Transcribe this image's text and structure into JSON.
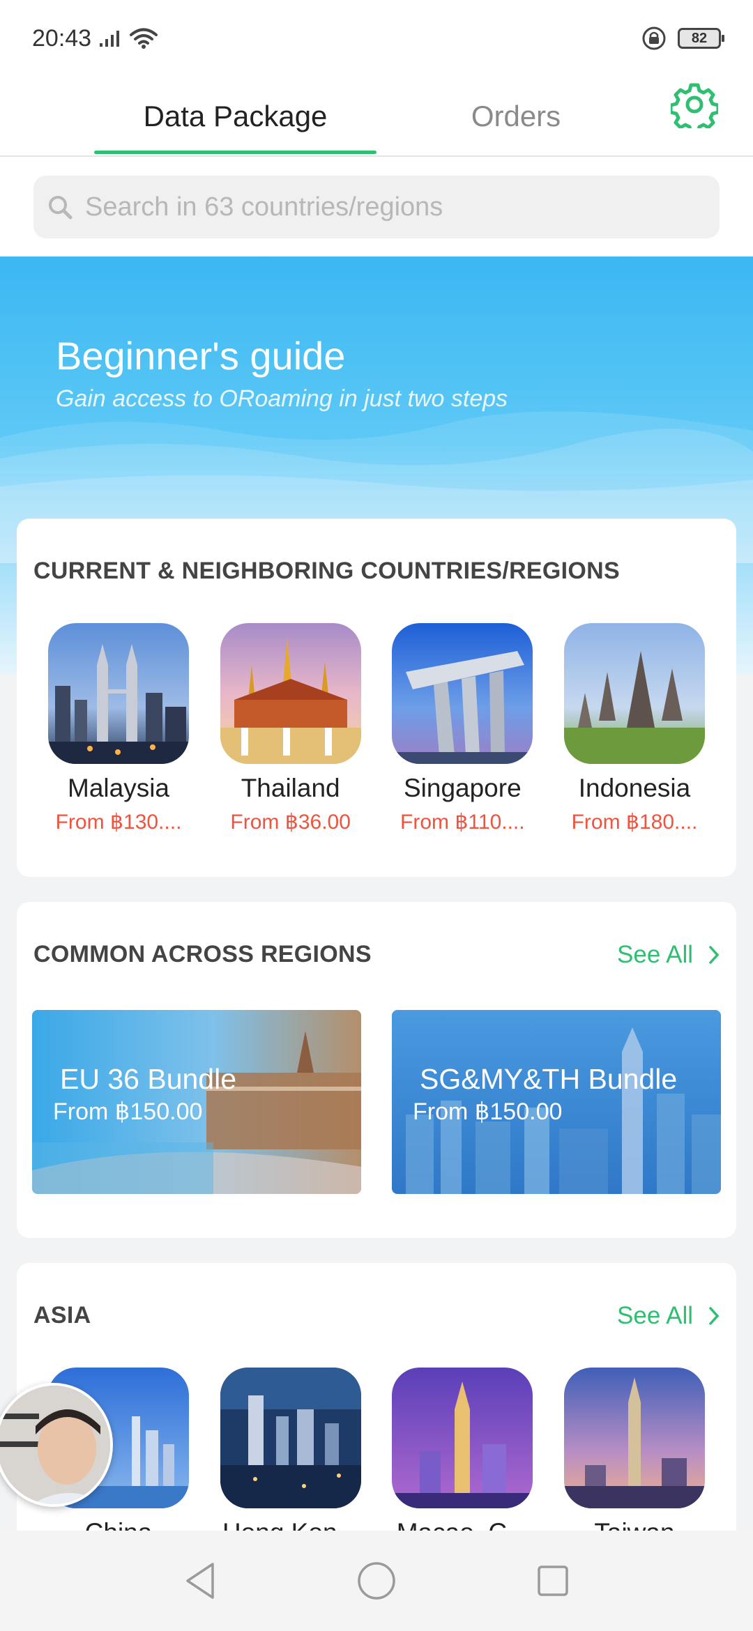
{
  "status_bar": {
    "time": "20:43",
    "battery": "82",
    "icons": [
      "signal-icon",
      "wifi-icon",
      "rotation-lock-icon",
      "battery-icon"
    ]
  },
  "tabs": [
    {
      "label": "Data Package",
      "active": true
    },
    {
      "label": "Orders",
      "active": false
    }
  ],
  "settings_icon": "gear-icon",
  "search": {
    "placeholder": "Search in 63 countries/regions",
    "value": ""
  },
  "banner": {
    "title": "Beginner's guide",
    "subtitle": "Gain access to ORoaming in just two steps"
  },
  "current_section": {
    "title": "CURRENT & NEIGHBORING COUNTRIES/REGIONS",
    "countries": [
      {
        "name": "Malaysia",
        "price": "From ฿130...."
      },
      {
        "name": "Thailand",
        "price": "From ฿36.00"
      },
      {
        "name": "Singapore",
        "price": "From ฿110...."
      },
      {
        "name": "Indonesia",
        "price": "From ฿180...."
      }
    ]
  },
  "common_section": {
    "title": "COMMON ACROSS REGIONS",
    "see_all": "See All",
    "bundles": [
      {
        "name": "EU 36 Bundle",
        "price": "From ฿150.00"
      },
      {
        "name": "SG&MY&TH Bundle",
        "price": "From ฿150.00"
      }
    ]
  },
  "asia_section": {
    "title": "ASIA",
    "see_all": "See All",
    "countries": [
      {
        "name": "China"
      },
      {
        "name": "Hong Kon..."
      },
      {
        "name": "Macao, C..."
      },
      {
        "name": "Taiwan"
      }
    ]
  },
  "colors": {
    "accent": "#2fbf71",
    "price": "#f0533e",
    "banner": "#3bb7f2"
  }
}
